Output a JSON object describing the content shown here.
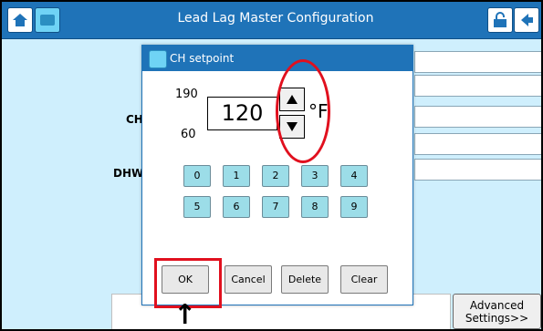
{
  "app": {
    "title": "Lead Lag Master Configuration"
  },
  "background": {
    "ch_label": "CH",
    "dhw_label": "DHW",
    "advanced_button_line1": "Advanced",
    "advanced_button_line2": "Settings>>"
  },
  "dialog": {
    "title": "CH setpoint",
    "max_label": "190",
    "min_label": "60",
    "value": "120",
    "unit": "°F",
    "keypad_row1": [
      "0",
      "1",
      "2",
      "3",
      "4"
    ],
    "keypad_row2": [
      "5",
      "6",
      "7",
      "8",
      "9"
    ],
    "ok_label": "OK",
    "cancel_label": "Cancel",
    "delete_label": "Delete",
    "clear_label": "Clear"
  },
  "annotation": {
    "arrow_symbol": "↑"
  }
}
